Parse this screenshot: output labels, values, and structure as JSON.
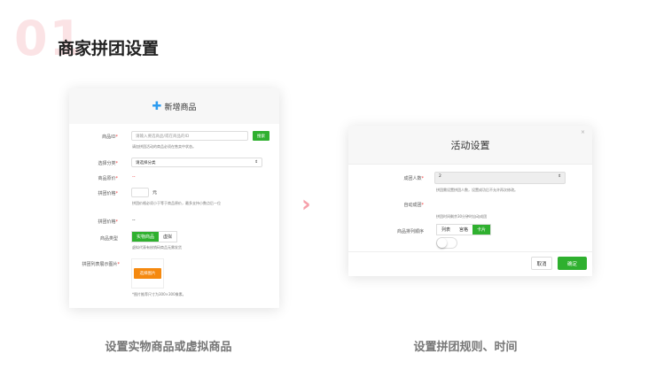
{
  "section": {
    "number": "01",
    "title": "商家拼团设置"
  },
  "left": {
    "header": "新增商品",
    "fields": {
      "id_label": "商品ID",
      "id_placeholder": "请输入要选商品/或在商品的ID",
      "search": "搜索",
      "id_hint": "请加拼团活动的商品必须在售卖中状态。",
      "cat_label": "选择分类",
      "cat_value": "请选择分类",
      "price_label": "商品原价",
      "price_value": "--",
      "gprice_label": "拼团价格",
      "unit": "元",
      "gprice_hint": "拼团价格必须小于等于商品原价，最多支持小数点后一位",
      "gprice2_label": "拼团价格",
      "gprice2_value": "--",
      "type_label": "商品类型",
      "type_options": [
        "实物商品",
        "虚拟"
      ],
      "type_hint": "虚拟代表有核销码商品无需发货",
      "img_label": "拼团列表展示图片",
      "img_button": "选择图片",
      "img_hint": "*图片推荐尺寸为300×300像素。"
    }
  },
  "right": {
    "title": "活动设置",
    "close": "×",
    "size_label": "成团人数",
    "size_value": "2",
    "size_hint": "拼团需设置拼团人数，设置成功后不允许再次修改。",
    "auto_label": "自动成团",
    "auto_on": false,
    "auto_hint": "拼团时间剩余30分钟时自动成团",
    "order_label": "商品排列顺序",
    "order_options": [
      "列表",
      "宫格",
      "卡片"
    ],
    "order_selected": "卡片",
    "cancel": "取消",
    "confirm": "确定"
  },
  "captions": [
    "设置实物商品或虚拟商品",
    "设置拼团规则、时间"
  ],
  "colors": {
    "accent": "#2fb02f",
    "orange": "#f5890f",
    "pink": "#f6a0aa"
  }
}
